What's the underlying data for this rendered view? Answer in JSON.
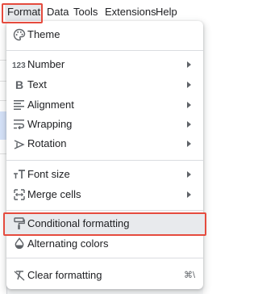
{
  "menubar": {
    "items": [
      "Format",
      "Data",
      "Tools",
      "Extensions",
      "Help"
    ]
  },
  "menu": {
    "items": [
      {
        "label": "Theme",
        "icon": "palette-icon"
      },
      {
        "label": "Number",
        "icon": "number-123-icon",
        "submenu": true
      },
      {
        "label": "Text",
        "icon": "bold-icon",
        "submenu": true
      },
      {
        "label": "Alignment",
        "icon": "align-left-icon",
        "submenu": true
      },
      {
        "label": "Wrapping",
        "icon": "text-wrap-icon",
        "submenu": true
      },
      {
        "label": "Rotation",
        "icon": "text-rotation-icon",
        "submenu": true
      },
      {
        "label": "Font size",
        "icon": "font-size-icon",
        "submenu": true
      },
      {
        "label": "Merge cells",
        "icon": "merge-cells-icon",
        "submenu": true
      },
      {
        "label": "Conditional formatting",
        "icon": "paint-roller-icon",
        "highlighted": true
      },
      {
        "label": "Alternating colors",
        "icon": "color-drop-icon"
      },
      {
        "label": "Clear formatting",
        "icon": "clear-format-icon",
        "shortcut": "⌘\\"
      }
    ]
  },
  "colors": {
    "highlight_border": "#e54b3e",
    "highlight_fill": "#e8eaed",
    "text": "#202124",
    "icon": "#5f6368"
  }
}
